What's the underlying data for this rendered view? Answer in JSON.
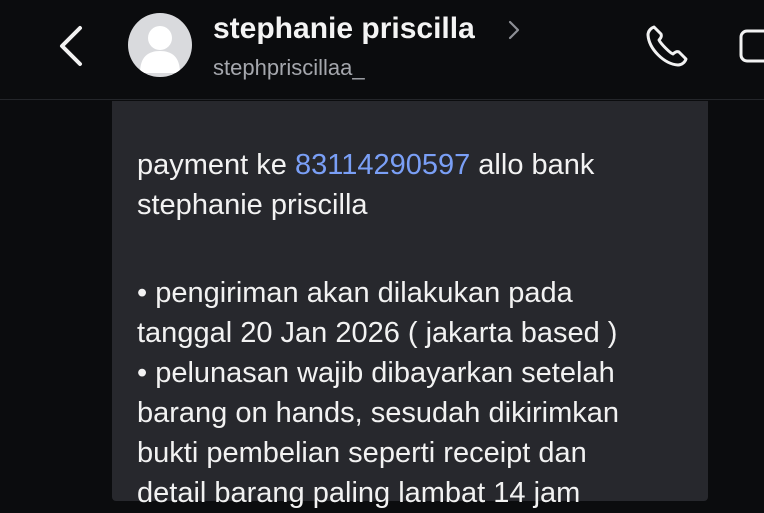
{
  "header": {
    "contact_name": "stephanie priscilla",
    "contact_handle": "stephpriscillaa_",
    "icons": [
      "back-chevron-icon",
      "avatar-placeholder-icon",
      "chevron-right-icon",
      "phone-icon",
      "video-camera-icon"
    ]
  },
  "message": {
    "line1_prefix": "payment ke ",
    "phone_number": "83114290597",
    "line1_suffix": " allo bank",
    "line2": "stephanie priscilla",
    "bullet1_line1": "• pengiriman akan dilakukan pada",
    "bullet1_line2": "tanggal 20 Jan 2026 ( jakarta based )",
    "bullet2_line1": "• pelunasan wajib dibayarkan setelah",
    "bullet2_line2": "barang on hands, sesudah dikirimkan",
    "bullet2_line3": "bukti pembelian seperti receipt dan",
    "bullet2_line4_partial": "detail barang paling lambat 14 jam"
  },
  "colors": {
    "background": "#0b0c0e",
    "bubble": "#27282d",
    "link": "#7a9ff6",
    "handle_text": "#a5a7ad"
  }
}
